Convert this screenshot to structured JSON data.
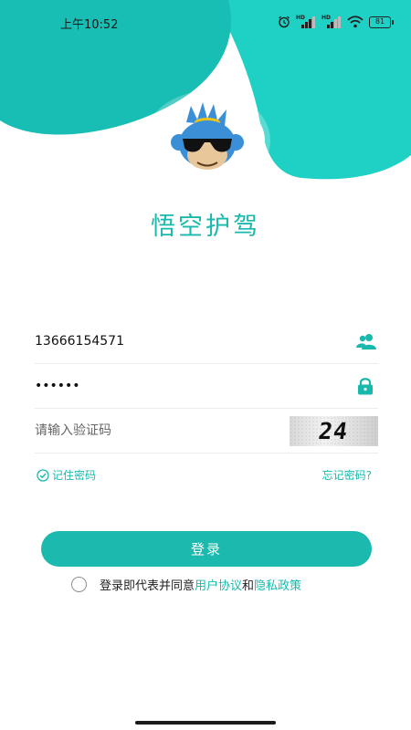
{
  "status_bar": {
    "time": "上午10:52",
    "battery": "81",
    "hd_label": "HD"
  },
  "app": {
    "title": "悟空护驾"
  },
  "form": {
    "phone_value": "13666154571",
    "password_value": "••••••",
    "captcha_placeholder": "请输入验证码",
    "captcha_code": "24"
  },
  "options": {
    "remember_label": "记住密码",
    "forgot_label": "忘记密码?"
  },
  "login_label": "登录",
  "agreement": {
    "prefix": "登录即代表并同意",
    "user_agreement": "用户协议",
    "conj": "和",
    "privacy_policy": "隐私政策"
  },
  "colors": {
    "accent": "#1AB9AD",
    "wave_light": "#1FD1C4",
    "wave_dark": "#18BDB3"
  },
  "icons": [
    "alarm-icon",
    "signal-icon",
    "wifi-icon",
    "battery-icon",
    "user-icon",
    "lock-icon",
    "check-circle-icon"
  ]
}
